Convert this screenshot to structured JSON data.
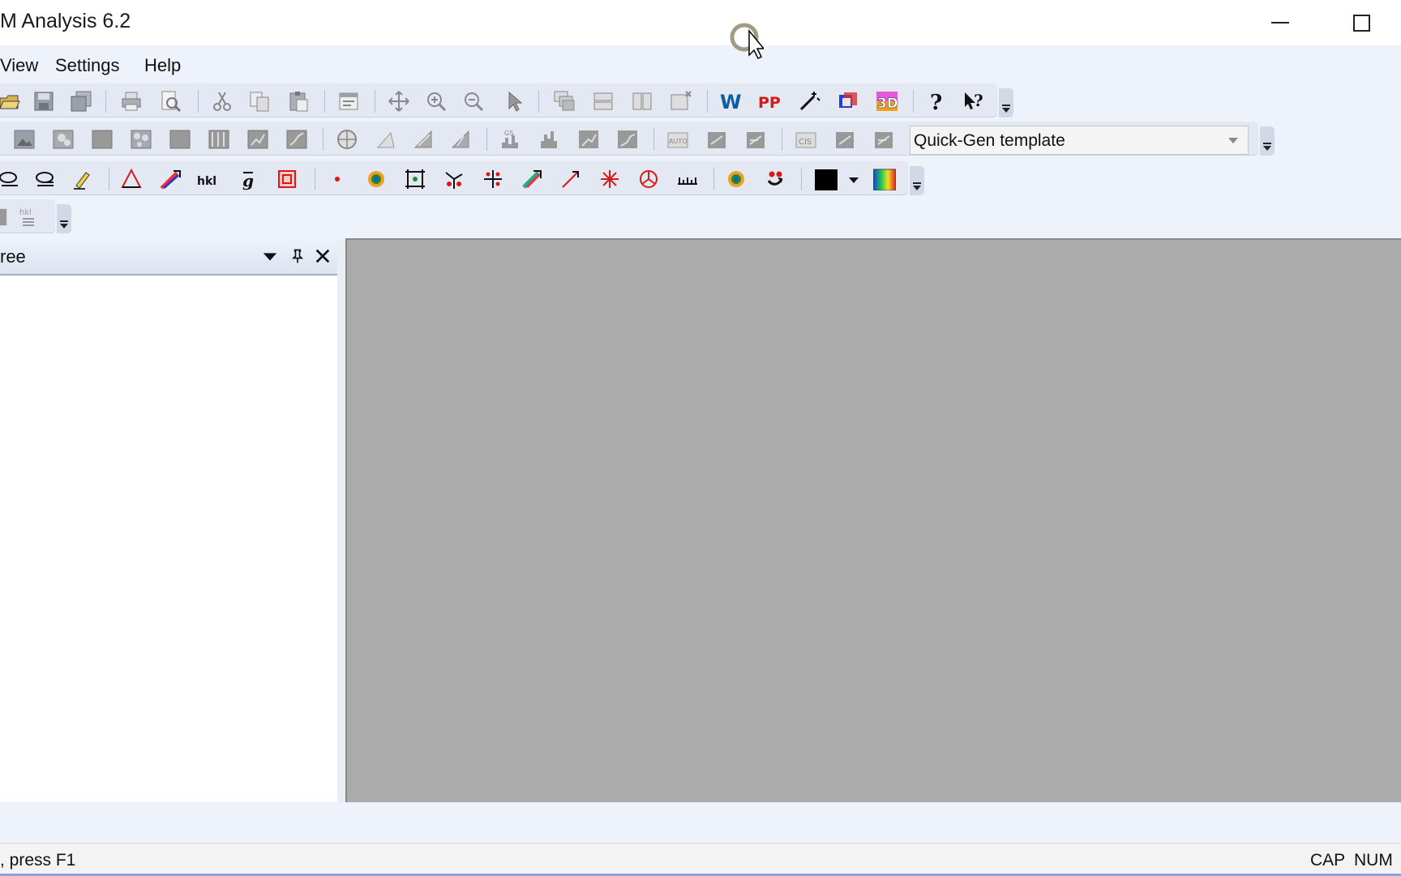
{
  "window": {
    "title": "M Analysis 6.2"
  },
  "menu": {
    "items": [
      "View",
      "Settings",
      "Help"
    ]
  },
  "toolbar2": {
    "template_combo_value": "Quick-Gen template"
  },
  "tree_panel": {
    "title": "ree"
  },
  "statusbar": {
    "message": ", press F1",
    "cap": "CAP",
    "num": "NUM"
  },
  "colors": {
    "accent_blue": "#1a5fb4",
    "accent_red": "#d61a1a",
    "workspace_gray": "#ababab"
  }
}
